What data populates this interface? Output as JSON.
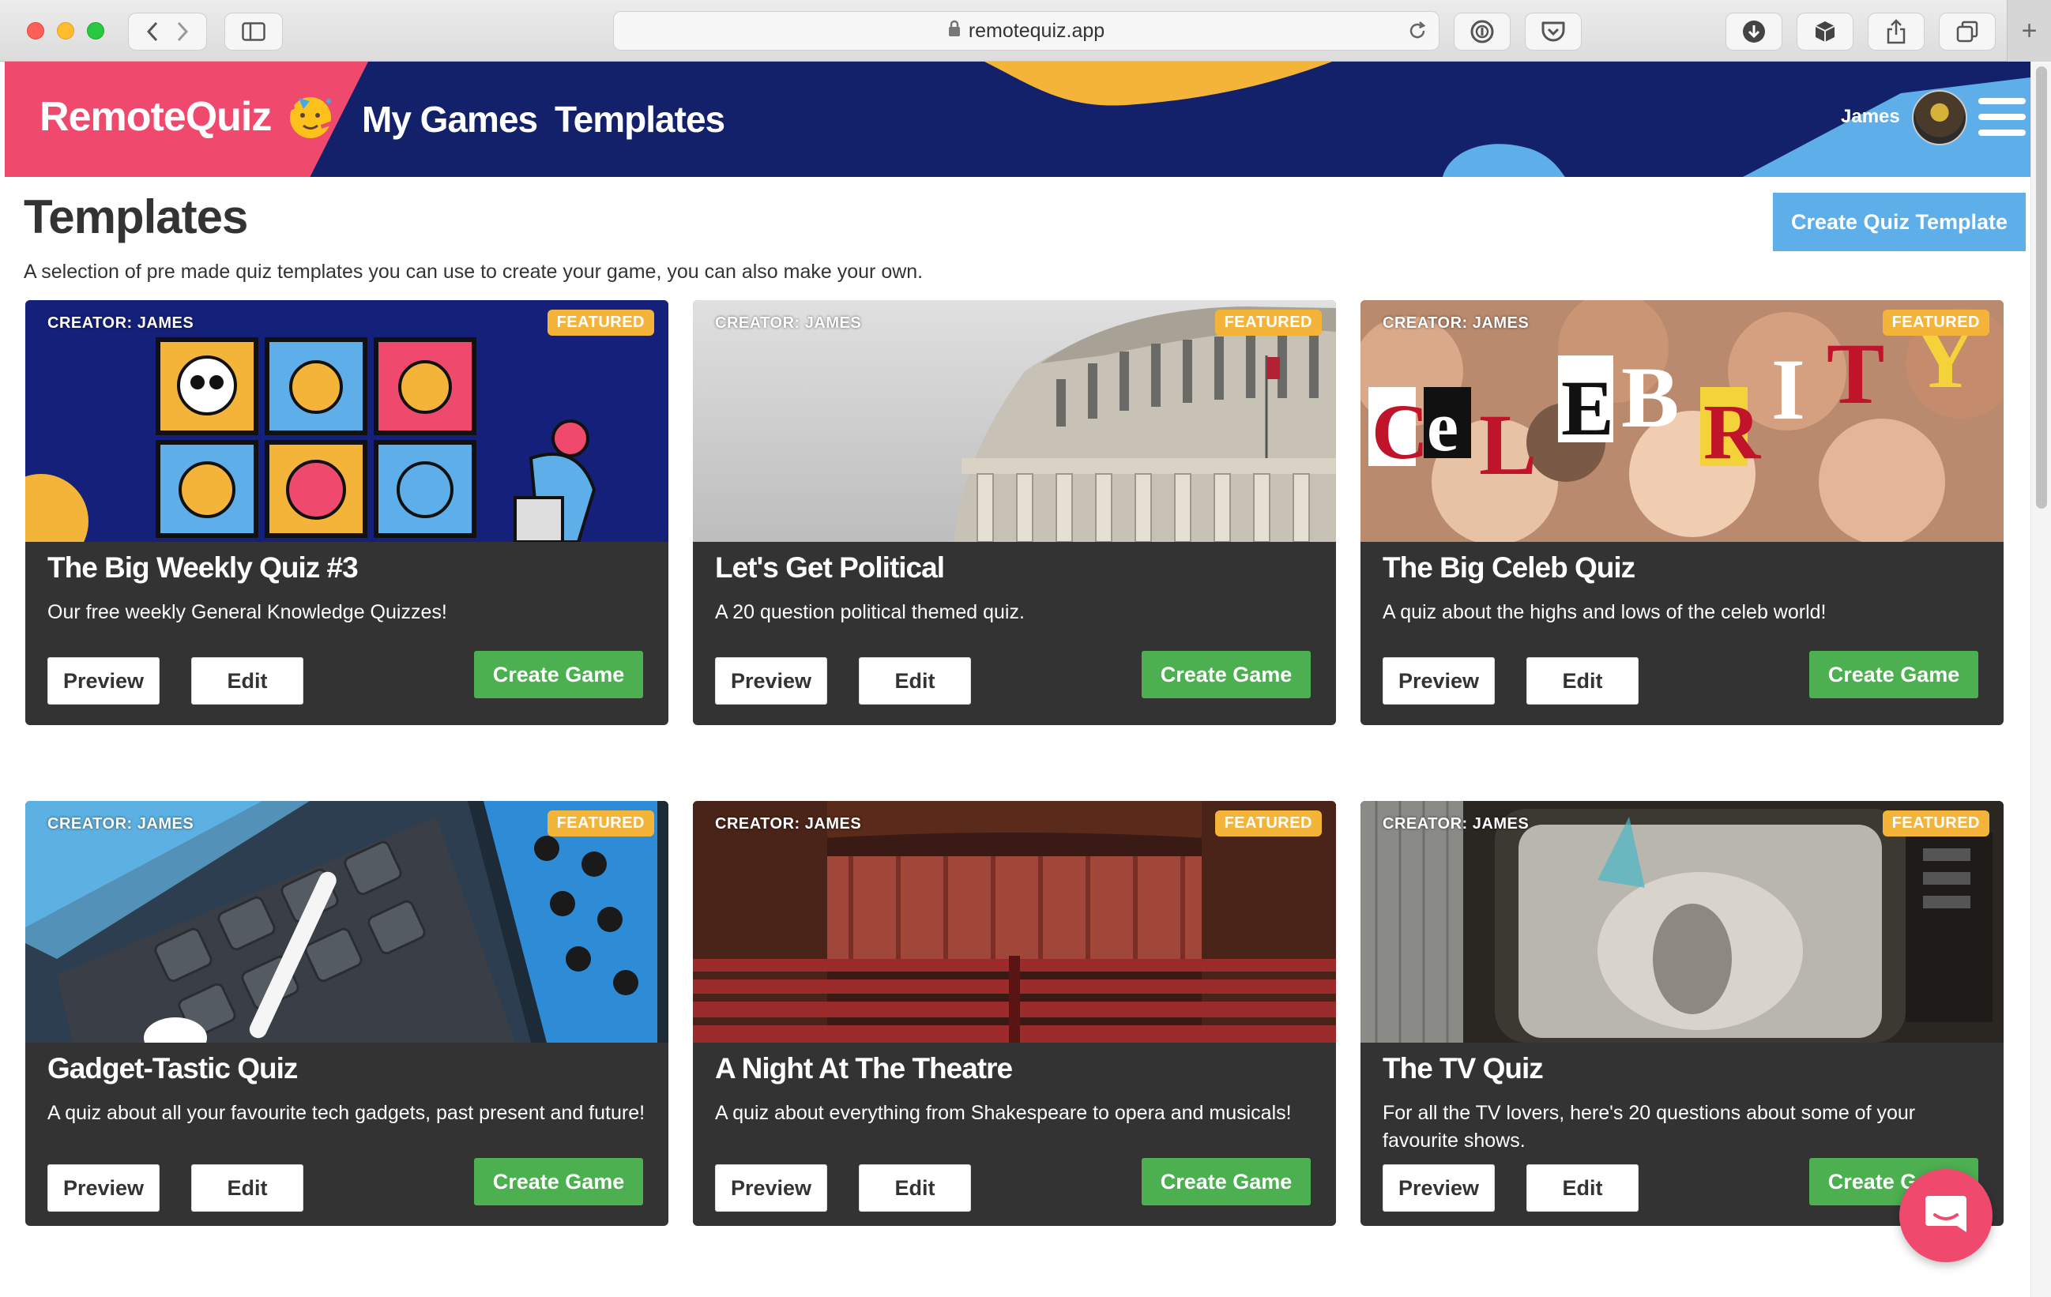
{
  "browser": {
    "url": "remotequiz.app",
    "colors": {
      "close": "#fe5f57",
      "minimize": "#febc2e",
      "maximize": "#28c840"
    }
  },
  "header": {
    "logo": "RemoteQuiz",
    "nav": {
      "my_games": "My Games",
      "templates": "Templates"
    },
    "user_name": "James",
    "colors": {
      "background": "#13206a",
      "logo_bg": "#ef4a6d",
      "accent_yellow": "#f4b43a",
      "accent_blue": "#5daee9"
    }
  },
  "page": {
    "title": "Templates",
    "subtitle": "A selection of pre made quiz templates you can use to create your game, you can also make your own.",
    "create_template_label": "Create Quiz Template"
  },
  "card_labels": {
    "preview": "Preview",
    "edit": "Edit",
    "create": "Create Game"
  },
  "cards": [
    {
      "creator": "CREATOR: JAMES",
      "badge": "FEATURED",
      "title": "The Big Weekly Quiz #3",
      "description": "Our free weekly General Knowledge Quizzes!"
    },
    {
      "creator": "CREATOR: JAMES",
      "badge": "FEATURED",
      "title": "Let's Get Political",
      "description": "A 20 question political themed quiz."
    },
    {
      "creator": "CREATOR: JAMES",
      "badge": "FEATURED",
      "title": "The Big Celeb Quiz",
      "description": "A quiz about the highs and lows of the celeb world!"
    },
    {
      "creator": "CREATOR: JAMES",
      "badge": "FEATURED",
      "title": "Gadget-Tastic Quiz",
      "description": "A quiz about all your favourite tech gadgets, past present and future!"
    },
    {
      "creator": "CREATOR: JAMES",
      "badge": "FEATURED",
      "title": "A Night At The Theatre",
      "description": "A quiz about everything from Shakespeare to opera and musicals!"
    },
    {
      "creator": "CREATOR: JAMES",
      "badge": "FEATURED",
      "title": "The TV Quiz",
      "description": "For all the TV lovers, here's 20 questions about some of your favourite shows."
    }
  ],
  "icons": [
    "back-icon",
    "forward-icon",
    "sidebar-icon",
    "lock-icon",
    "reload-icon",
    "password-icon",
    "pocket-icon",
    "download-icon",
    "extension-icon",
    "share-icon",
    "tabs-icon",
    "plus-icon",
    "hamburger-icon",
    "chat-icon"
  ]
}
